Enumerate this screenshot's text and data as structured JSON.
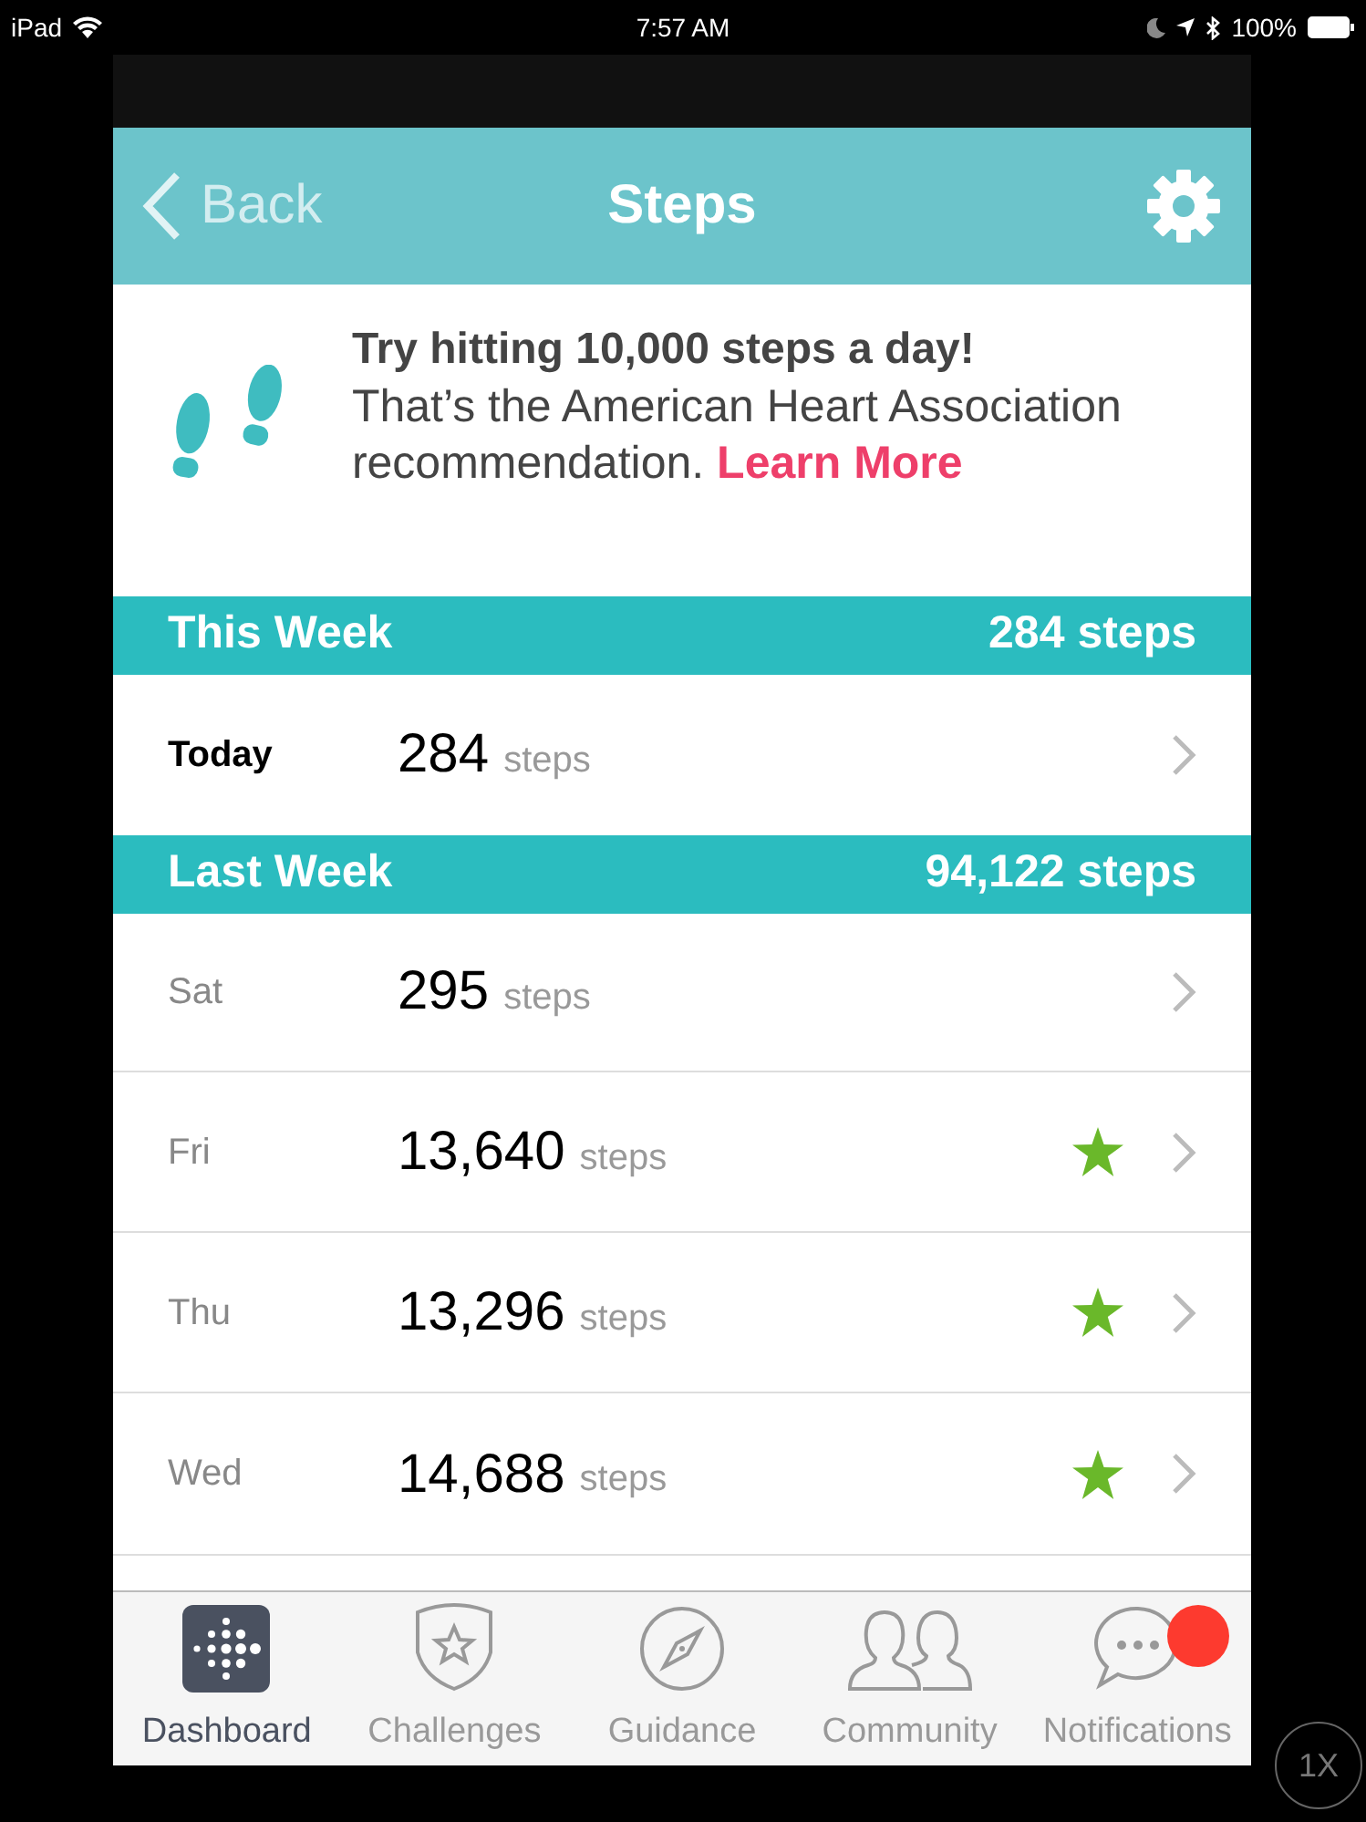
{
  "status_bar": {
    "device": "iPad",
    "time": "7:57 AM",
    "battery": "100%"
  },
  "header": {
    "back": "Back",
    "title": "Steps"
  },
  "tip": {
    "headline": "Try hitting 10,000 steps a day!",
    "body": "That’s the American Heart Association recommendation.",
    "link": "Learn More"
  },
  "sections": [
    {
      "title": "This Week",
      "total": "284 steps",
      "rows": [
        {
          "label": "Today",
          "count": "284",
          "unit": "steps",
          "current": true,
          "goal_met": false
        }
      ]
    },
    {
      "title": "Last Week",
      "total": "94,122 steps",
      "rows": [
        {
          "label": "Sat",
          "count": "295",
          "unit": "steps",
          "current": false,
          "goal_met": false
        },
        {
          "label": "Fri",
          "count": "13,640",
          "unit": "steps",
          "current": false,
          "goal_met": true
        },
        {
          "label": "Thu",
          "count": "13,296",
          "unit": "steps",
          "current": false,
          "goal_met": true
        },
        {
          "label": "Wed",
          "count": "14,688",
          "unit": "steps",
          "current": false,
          "goal_met": true
        }
      ]
    }
  ],
  "tabs": [
    {
      "kind": "dashboard",
      "label": "Dashboard",
      "selected": true,
      "alert": false
    },
    {
      "kind": "challenges",
      "label": "Challenges",
      "selected": false,
      "alert": false
    },
    {
      "kind": "guidance",
      "label": "Guidance",
      "selected": false,
      "alert": false
    },
    {
      "kind": "community",
      "label": "Community",
      "selected": false,
      "alert": false
    },
    {
      "kind": "notifications",
      "label": "Notifications",
      "selected": false,
      "alert": true
    }
  ],
  "zoom_button": "1X"
}
